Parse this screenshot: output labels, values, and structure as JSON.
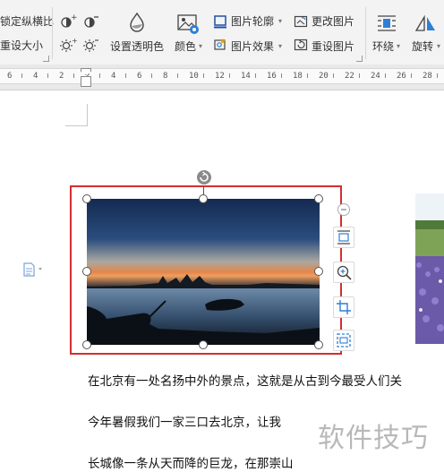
{
  "toolbar": {
    "lock_ratio_label": "锁定纵横比",
    "reset_size_label": "重设大小",
    "set_transparent_label": "设置透明色",
    "color_label": "颜色",
    "picture_outline_label": "图片轮廓",
    "picture_effects_label": "图片效果",
    "change_picture_label": "更改图片",
    "reset_picture_label": "重设图片",
    "wrap_label": "环绕",
    "rotate_label": "旋转"
  },
  "ruler": {
    "numbers": [
      "6",
      "4",
      "2",
      "2",
      "4",
      "6",
      "8",
      "10",
      "12",
      "14",
      "16",
      "18",
      "20",
      "22",
      "24",
      "26",
      "28"
    ]
  },
  "document": {
    "paragraphs": [
      "在北京有一处名扬中外的景点，这就是从古到今最受人们关",
      "今年暑假我们一家三口去北京，让我",
      "长城像一条从天而降的巨龙，在那崇山"
    ]
  },
  "watermark": "软件技巧",
  "colors": {
    "selection_border": "#d32f2f",
    "sky_top": "#142a52",
    "sunset_glow": "#e4864a"
  }
}
